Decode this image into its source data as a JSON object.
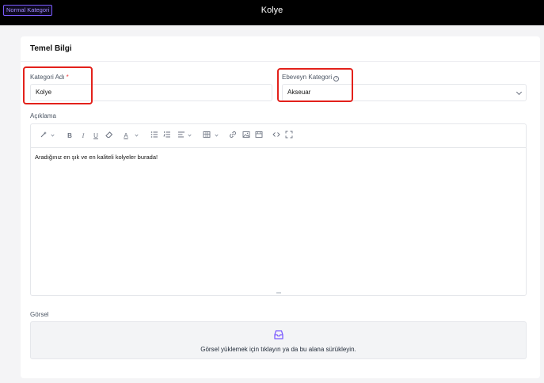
{
  "header": {
    "badge": "Normal Kategori",
    "title": "Kolye"
  },
  "section": {
    "title": "Temel Bilgi"
  },
  "form": {
    "name": {
      "label": "Kategori Adı",
      "required_mark": "*",
      "value": "Kolye"
    },
    "parent": {
      "label": "Ebeveyn Kategori",
      "value": "Akseuar",
      "info_icon": "info-icon"
    },
    "description": {
      "label": "Açıklama",
      "text": "Aradığınız en şık ve en kaliteli kolyeler burada!"
    },
    "image": {
      "label": "Görsel",
      "hint": "Görsel yüklemek için tıklayın ya da bu alana sürükleyin.",
      "icon": "inbox-icon"
    }
  },
  "toolbar": {
    "icons": [
      "magic-wand-icon",
      "bold-icon",
      "italic-icon",
      "underline-icon",
      "eraser-icon",
      "font-color-icon",
      "bullet-list-icon",
      "numbered-list-icon",
      "align-icon",
      "table-icon",
      "link-icon",
      "image-icon",
      "video-icon",
      "code-icon",
      "fullscreen-icon"
    ]
  },
  "colors": {
    "accent": "#7c5cff",
    "highlight": "#e3211b",
    "topbar": "#000000"
  }
}
